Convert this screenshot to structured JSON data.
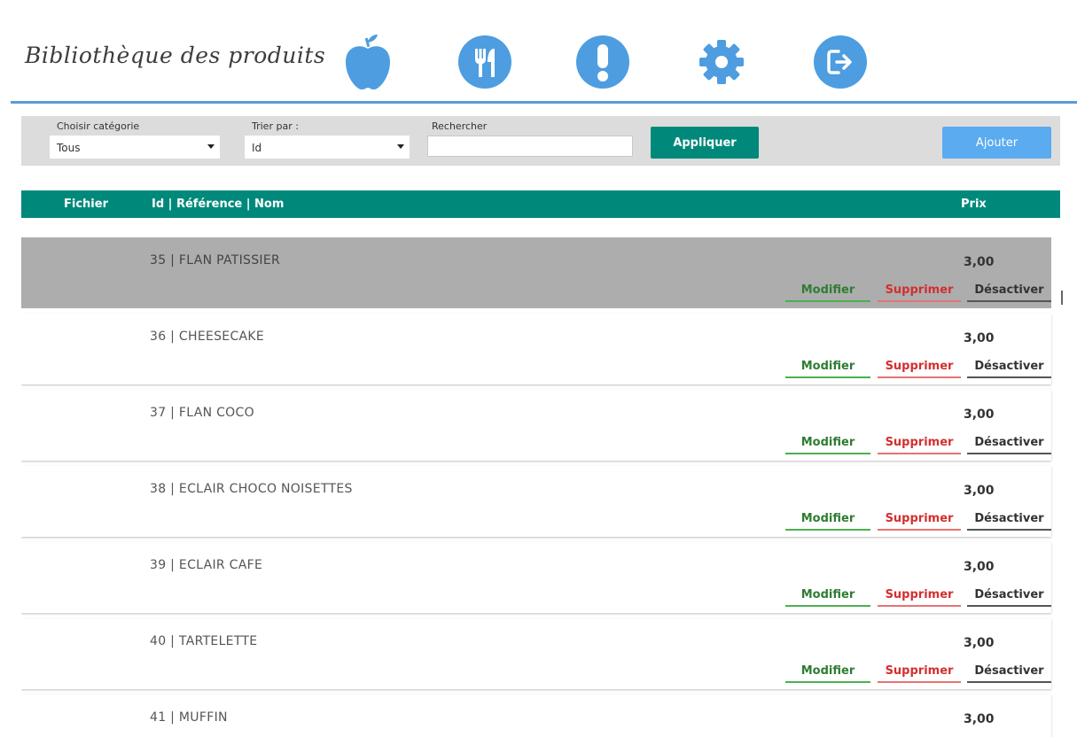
{
  "header": {
    "title": "Bibliothèque des produits",
    "nav": [
      {
        "icon": "apple-icon"
      },
      {
        "icon": "fork-knife-icon"
      },
      {
        "icon": "alert-icon"
      },
      {
        "icon": "gear-icon"
      },
      {
        "icon": "logout-icon"
      }
    ],
    "accent_color": "#5b9bd5",
    "icon_color": "#4d9de0"
  },
  "filters": {
    "category_label": "Choisir catégorie",
    "category_value": "Tous",
    "sort_label": "Trier par :",
    "sort_value": "Id",
    "search_label": "Rechercher",
    "search_value": "",
    "apply_label": "Appliquer",
    "add_label": "Ajouter"
  },
  "table": {
    "header_color": "#00897b",
    "columns": {
      "file": "Fichier",
      "name": "Id | Référence | Nom",
      "price": "Prix"
    },
    "actions": {
      "edit": "Modifier",
      "delete": "Supprimer",
      "disable": "Désactiver"
    },
    "rows": [
      {
        "label": "35 | FLAN PATISSIER",
        "price": "3,00",
        "selected": true
      },
      {
        "label": "36 | CHEESECAKE",
        "price": "3,00",
        "selected": false
      },
      {
        "label": "37 | FLAN COCO",
        "price": "3,00",
        "selected": false
      },
      {
        "label": "38 | ECLAIR CHOCO NOISETTES",
        "price": "3,00",
        "selected": false
      },
      {
        "label": "39 | ECLAIR CAFE",
        "price": "3,00",
        "selected": false
      },
      {
        "label": "40 | TARTELETTE",
        "price": "3,00",
        "selected": false
      },
      {
        "label": "41 | MUFFIN",
        "price": "3,00",
        "selected": false
      }
    ]
  }
}
